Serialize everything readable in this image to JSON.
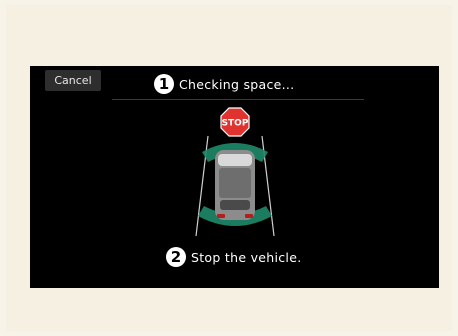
{
  "screen": {
    "cancel_label": "Cancel",
    "step1": {
      "number": "1",
      "text": "Checking space..."
    },
    "step2": {
      "number": "2",
      "text": "Stop the vehicle."
    },
    "stop_sign_text": "STOP"
  },
  "colors": {
    "background": "#000000",
    "sensor_zone": "#1f8a6a",
    "stop_sign": "#e0322e",
    "text": "#ffffff"
  },
  "icons": [
    "stop-sign-icon",
    "car-icon",
    "step-1-badge",
    "step-2-badge"
  ]
}
